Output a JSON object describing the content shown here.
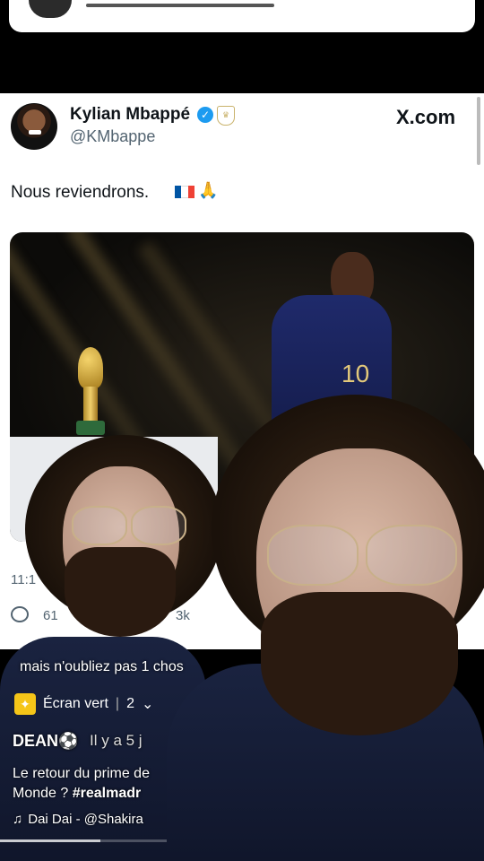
{
  "tweet": {
    "author_name": "Kylian Mbappé",
    "handle": "@KMbappe",
    "site": "X.com",
    "text": "Nous reviendrons.",
    "timestamp": "11:1",
    "reply_count": "61",
    "like_count": "3k",
    "jersey_number": "10"
  },
  "tiktok": {
    "caption_overlay": "mais n'oubliez pas 1 chos",
    "effect_label": "Écran vert",
    "effect_count": "2",
    "username": "DEAN⚽",
    "posted": "Il y a 5 j",
    "description_line1": "Le retour du prime de",
    "description_line2_prefix": "Monde ?",
    "hashtag": "#realmadr",
    "music": "Dai Dai - @Shakira",
    "progress_fraction": 0.6
  },
  "colors": {
    "verified_blue": "#1d9bf0",
    "effect_yellow": "#f5c518",
    "flag_blue": "#0055a4",
    "flag_red": "#ef4135"
  }
}
